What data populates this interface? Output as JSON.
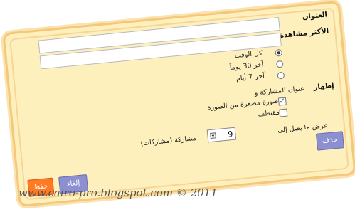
{
  "form": {
    "title_label": "العنوان",
    "most_viewed_label": "الأكثر مشاهدة",
    "radio_options": [
      {
        "label": "كل الوقت",
        "checked": true
      },
      {
        "label": "آخر 30 يوماً",
        "checked": false
      },
      {
        "label": "آخر 7 أيام",
        "checked": false
      }
    ],
    "show_label": "إظهار",
    "post_title_label": "عنوان المشاركة و",
    "checkboxes": [
      {
        "label": "صورة مصغرة من الصورة",
        "checked": true
      },
      {
        "label": "مقتطف",
        "checked": false
      }
    ],
    "display_up_to_label": "عرض ما يصل إلى",
    "count_value": "9",
    "posts_label": "مشاركة (مشاركات)"
  },
  "buttons": {
    "delete": "حذف",
    "cancel": "إلغاء",
    "save": "حفظ"
  },
  "watermark": "www.cairo-pro.blogspot.com © 2011"
}
